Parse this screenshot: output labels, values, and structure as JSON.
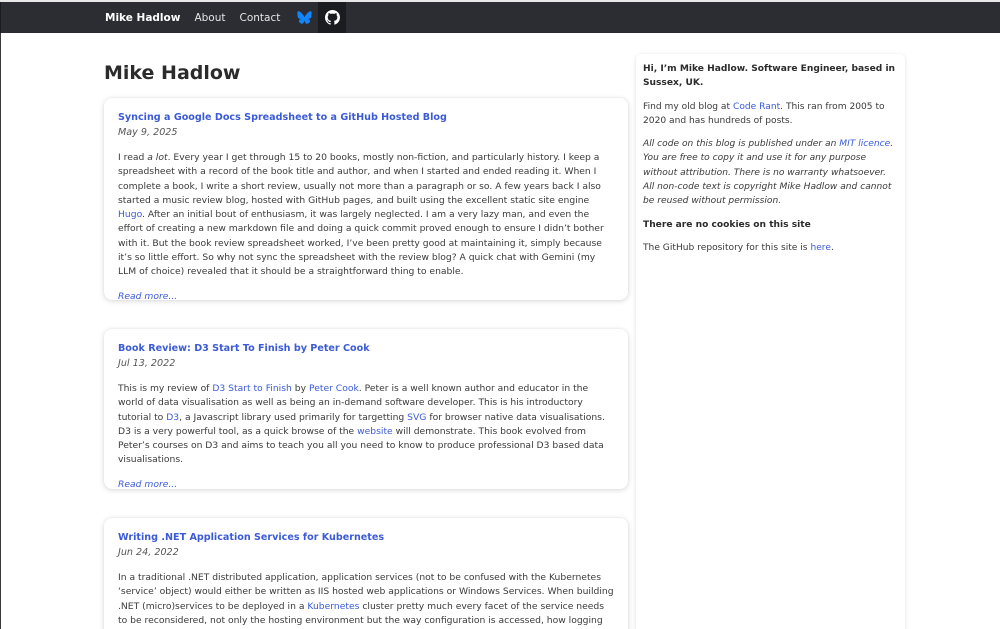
{
  "nav": {
    "brand": "Mike Hadlow",
    "links": [
      "About",
      "Contact"
    ],
    "icons": [
      "bluesky-icon",
      "github-icon"
    ],
    "colors": {
      "bar": "#2b2d33",
      "bluesky": "#1185fe"
    }
  },
  "main": {
    "title": "Mike Hadlow",
    "posts": [
      {
        "title": "Syncing a Google Docs Spreadsheet to a GitHub Hosted Blog",
        "date": "May 9, 2025",
        "p1": "I read ",
        "p1_em": "a lot",
        "p2": ". Every year I get through 15 to 20 books, mostly non-fiction, and particularly history. I keep a spreadsheet with a record of the book title and author, and when I started and ended reading it. When I complete a book, I write a short review, usually not more than a paragraph or so. A few years back I also started a music review blog, hosted with GitHub pages, and built using the excellent static site engine ",
        "link1": "Hugo",
        "p3": ". After an initial bout of enthusiasm, it was largely neglected. I am a very lazy man, and even the effort of creating a new markdown file and doing a quick commit proved enough to ensure I didn’t bother with it. But the book review spreadsheet worked, I’ve been pretty good at maintaining it, simply because it’s so little effort. So why not sync the spreadsheet with the review blog? A quick chat with Gemini (my LLM of choice) revealed that it should be a straightforward thing to enable.",
        "read_more": "Read more..."
      },
      {
        "title": "Book Review: D3 Start To Finish by Peter Cook",
        "date": "Jul 13, 2022",
        "t1": "This is my review of ",
        "l1": "D3 Start to Finish",
        "t2": " by ",
        "l2": "Peter Cook",
        "t3": ". Peter is a well known author and educator in the world of data visualisation as well as being an in-demand software developer. This is his introductory tutorial to ",
        "l3": "D3",
        "t4": ", a Javascript library used primarily for targetting ",
        "l4": "SVG",
        "t5": " for browser native data visualisations. D3 is a very powerful tool, as a quick browse of the ",
        "l5": "website",
        "t6": " will demonstrate. This book evolved from Peter’s courses on D3 and aims to teach you all you need to know to produce professional D3 based data visualisations.",
        "read_more": "Read more..."
      },
      {
        "title": "Writing .NET Application Services for Kubernetes",
        "date": "Jun 24, 2022",
        "t1": "In a traditional .NET distributed application, application services (not to be confused with the Kubernetes ‘service’ object) would either be written as IIS hosted web applications or Windows Services. When building .NET (micro)services to be deployed in a ",
        "l1": "Kubernetes",
        "t2": " cluster pretty much every facet of the service needs to be reconsidered, not only the hosting environment but the way configuration is accessed, how logging and monitoring"
      }
    ]
  },
  "sidebar": {
    "intro": "Hi, I’m Mike Hadlow. Software Engineer, based in Sussex, UK.",
    "old1": "Find my old blog at ",
    "old_link": "Code Rant",
    "old2": ". This ran from 2005 to 2020 and has hundreds of posts.",
    "lic1": "All code on this blog is published under an ",
    "lic_link": "MIT licence",
    "lic2": ". You are free to copy it and use it for any purpose without attribution. There is no warranty whatsoever. All non-code text is copyright Mike Hadlow and cannot be reused without permission.",
    "cookies": "There are no cookies on this site",
    "repo1": "The GitHub repository for this site is ",
    "repo_link": "here",
    "repo2": "."
  }
}
